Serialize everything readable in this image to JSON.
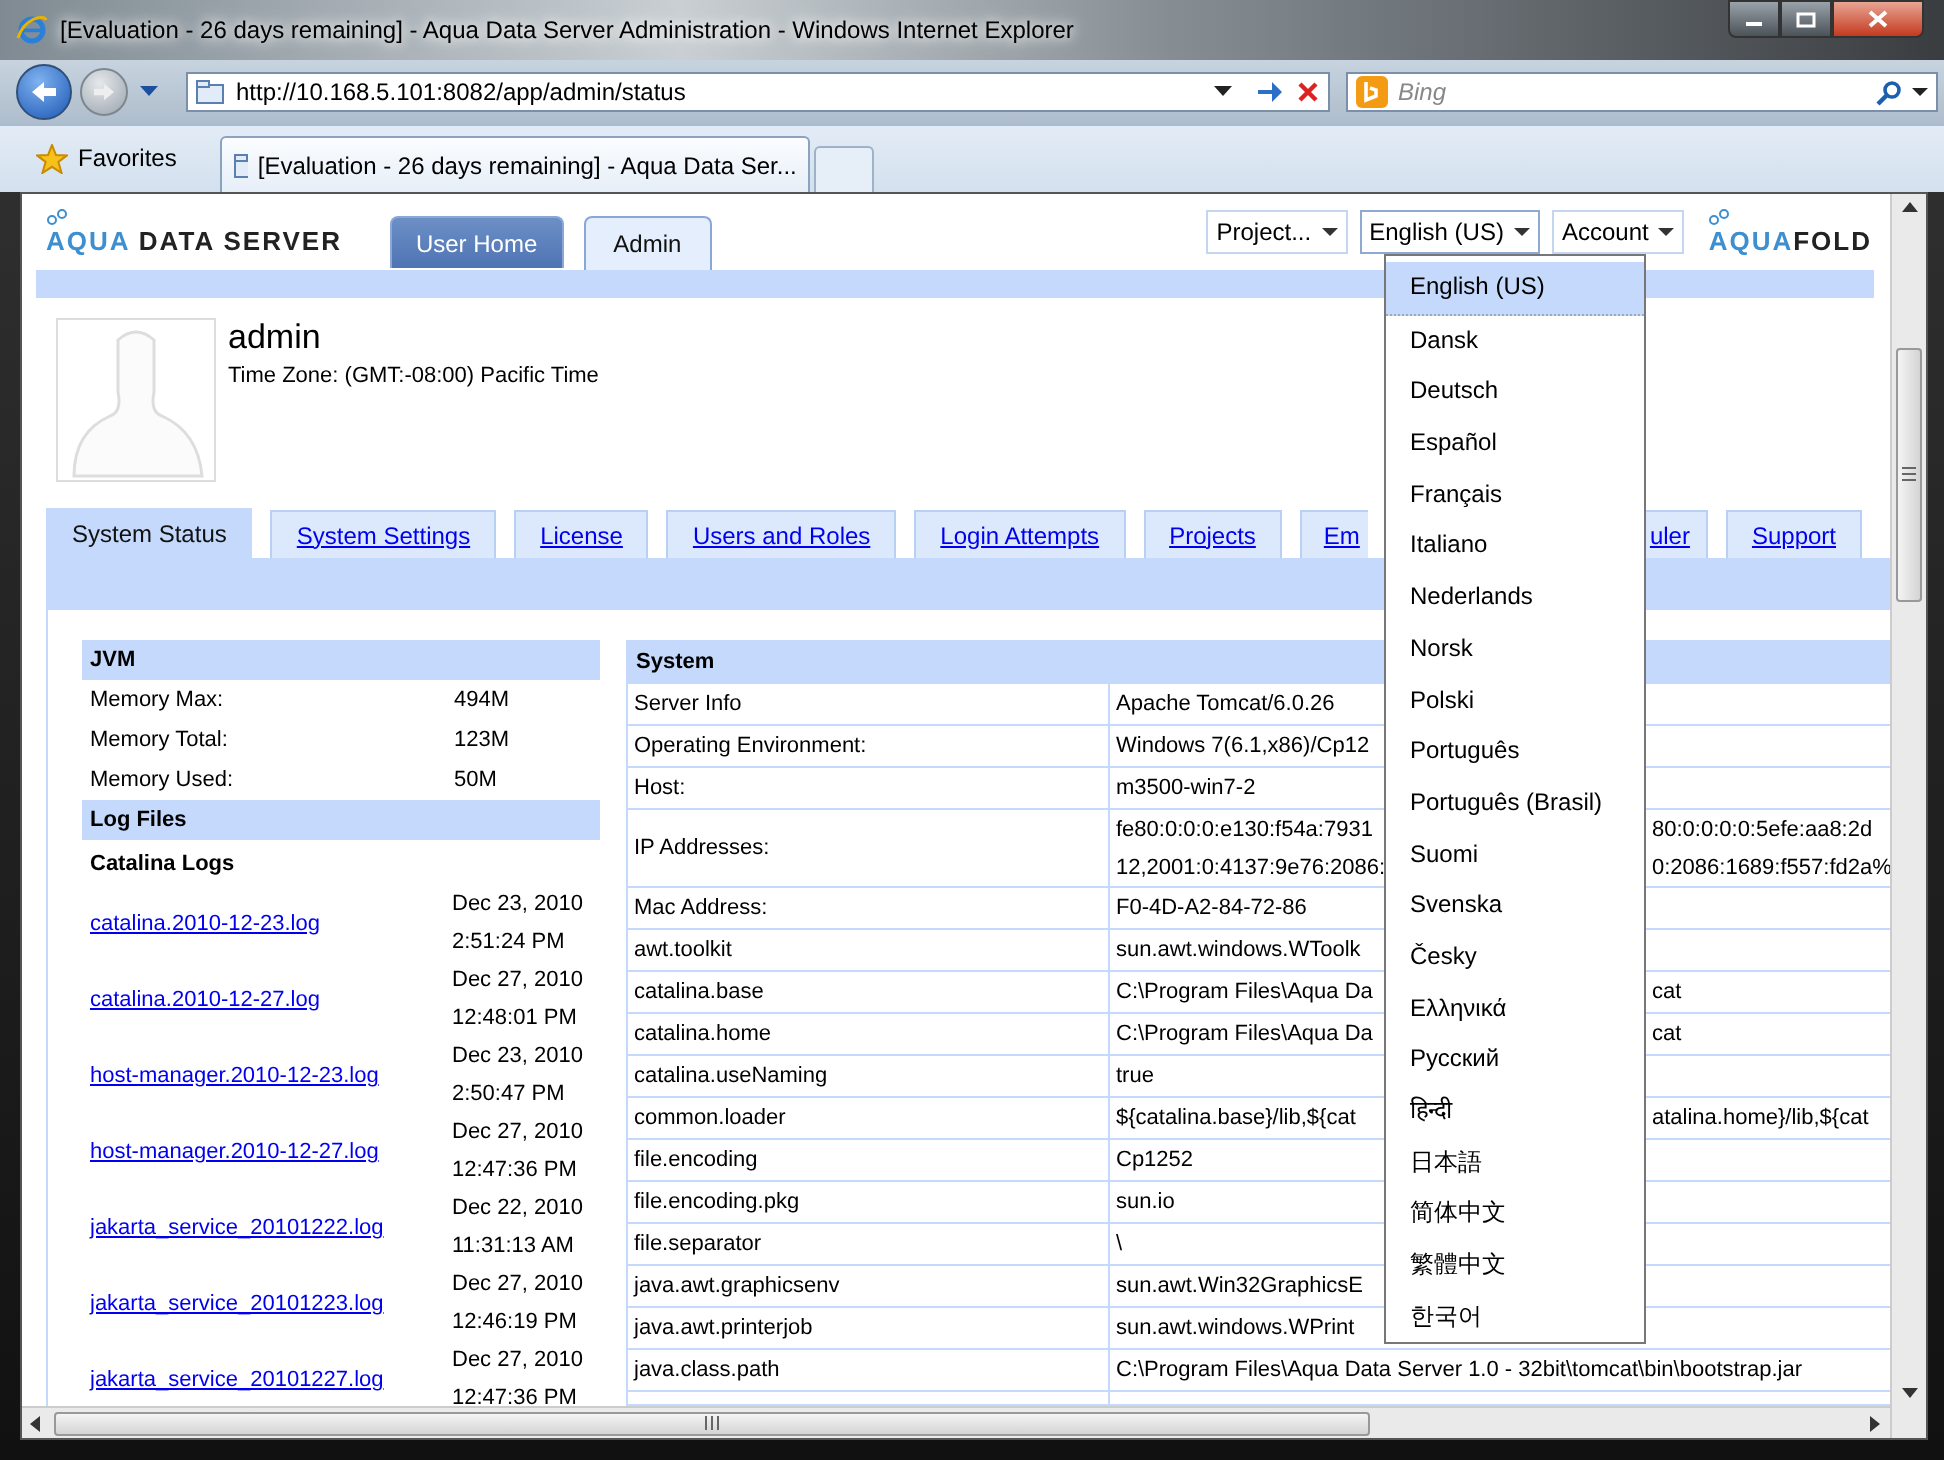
{
  "window": {
    "title": "[Evaluation - 26 days remaining] - Aqua Data Server Administration - Windows Internet Explorer"
  },
  "address_bar": {
    "url": "http://10.168.5.101:8082/app/admin/status"
  },
  "search": {
    "placeholder": "Bing"
  },
  "favorites": {
    "label": "Favorites"
  },
  "browser_tabs": [
    {
      "label": "[Evaluation - 26 days remaining] - Aqua Data Ser...",
      "selected": true
    }
  ],
  "logo": {
    "part_1": "AQUA",
    "part_2": "DATA SERVER"
  },
  "vendor_logo": {
    "part_1": "AQUA",
    "part_2": "FOLD"
  },
  "app_tabs": [
    {
      "label": "User Home",
      "selected": false
    },
    {
      "label": "Admin",
      "selected": true
    }
  ],
  "menus": [
    {
      "label": "Project...",
      "open": false
    },
    {
      "label": "English (US)",
      "open": true
    },
    {
      "label": "Account",
      "open": false
    }
  ],
  "language_menu": [
    {
      "label": "English (US)",
      "selected": true
    },
    {
      "label": "Dansk",
      "selected": false
    },
    {
      "label": "Deutsch",
      "selected": false
    },
    {
      "label": "Español",
      "selected": false
    },
    {
      "label": "Français",
      "selected": false
    },
    {
      "label": "Italiano",
      "selected": false
    },
    {
      "label": "Nederlands",
      "selected": false
    },
    {
      "label": "Norsk",
      "selected": false
    },
    {
      "label": "Polski",
      "selected": false
    },
    {
      "label": "Português",
      "selected": false
    },
    {
      "label": "Português (Brasil)",
      "selected": false
    },
    {
      "label": "Suomi",
      "selected": false
    },
    {
      "label": "Svenska",
      "selected": false
    },
    {
      "label": "Česky",
      "selected": false
    },
    {
      "label": "Ελληνικά",
      "selected": false
    },
    {
      "label": "Русский",
      "selected": false
    },
    {
      "label": "हिन्दी",
      "selected": false
    },
    {
      "label": "日本語",
      "selected": false
    },
    {
      "label": "简体中文",
      "selected": false
    },
    {
      "label": "繁體中文",
      "selected": false
    },
    {
      "label": "한국어",
      "selected": false
    }
  ],
  "user": {
    "name": "admin",
    "time_zone": "Time Zone: (GMT:-08:00) Pacific Time"
  },
  "admin_tabs": [
    {
      "label": "System Status",
      "selected": true
    },
    {
      "label": "System Settings",
      "selected": false
    },
    {
      "label": "License",
      "selected": false
    },
    {
      "label": "Users and Roles",
      "selected": false
    },
    {
      "label": "Login Attempts",
      "selected": false
    },
    {
      "label": "Projects",
      "selected": false
    },
    {
      "label": "Em",
      "selected": false
    },
    {
      "label": "uler",
      "selected": false
    },
    {
      "label": "Support",
      "selected": false
    }
  ],
  "jvm": {
    "title": "JVM",
    "rows": [
      {
        "label": "Memory Max:",
        "value": "494M"
      },
      {
        "label": "Memory Total:",
        "value": "123M"
      },
      {
        "label": "Memory Used:",
        "value": "50M"
      }
    ]
  },
  "log_files": {
    "title": "Log Files",
    "group": "Catalina Logs",
    "files": [
      {
        "name": "catalina.2010-12-23.log",
        "date": "Dec 23, 2010",
        "time": "2:51:24 PM"
      },
      {
        "name": "catalina.2010-12-27.log",
        "date": "Dec 27, 2010",
        "time": "12:48:01 PM"
      },
      {
        "name": "host-manager.2010-12-23.log",
        "date": "Dec 23, 2010",
        "time": "2:50:47 PM"
      },
      {
        "name": "host-manager.2010-12-27.log",
        "date": "Dec 27, 2010",
        "time": "12:47:36 PM"
      },
      {
        "name": "jakarta_service_20101222.log",
        "date": "Dec 22, 2010",
        "time": "11:31:13 AM"
      },
      {
        "name": "jakarta_service_20101223.log",
        "date": "Dec 27, 2010",
        "time": "12:46:19 PM"
      },
      {
        "name": "jakarta_service_20101227.log",
        "date": "Dec 27, 2010",
        "time": "12:47:36 PM"
      }
    ]
  },
  "system": {
    "title": "System",
    "rows": [
      {
        "label": "Server Info",
        "lines": [
          {
            "text": "Apache Tomcat/6.0.26"
          }
        ]
      },
      {
        "label": "Operating Environment:",
        "lines": [
          {
            "text": "Windows 7(6.1,x86)/Cp12"
          }
        ]
      },
      {
        "label": "Host:",
        "lines": [
          {
            "text": "m3500-win7-2"
          }
        ]
      },
      {
        "label": "IP Addresses:",
        "lines": [
          {
            "text": "fe80:0:0:0:e130:f54a:7931",
            "text_right": "80:0:0:0:0:5efe:aa8:2d"
          },
          {
            "text": "12,2001:0:4137:9e76:2086:",
            "text_right": "0:2086:1689:f557:fd2a%"
          }
        ]
      },
      {
        "label": "Mac Address:",
        "lines": [
          {
            "text": "F0-4D-A2-84-72-86"
          }
        ]
      },
      {
        "label": "awt.toolkit",
        "lines": [
          {
            "text": "sun.awt.windows.WToolk"
          }
        ]
      },
      {
        "label": "catalina.base",
        "lines": [
          {
            "text": "C:\\Program Files\\Aqua Da",
            "text_right": "cat"
          }
        ]
      },
      {
        "label": "catalina.home",
        "lines": [
          {
            "text": "C:\\Program Files\\Aqua Da",
            "text_right": "cat"
          }
        ]
      },
      {
        "label": "catalina.useNaming",
        "lines": [
          {
            "text": "true"
          }
        ]
      },
      {
        "label": "common.loader",
        "lines": [
          {
            "text": "${catalina.base}/lib,${cat",
            "text_right": "atalina.home}/lib,${cat"
          }
        ]
      },
      {
        "label": "file.encoding",
        "lines": [
          {
            "text": "Cp1252"
          }
        ]
      },
      {
        "label": "file.encoding.pkg",
        "lines": [
          {
            "text": "sun.io"
          }
        ]
      },
      {
        "label": "file.separator",
        "lines": [
          {
            "text": "\\"
          }
        ]
      },
      {
        "label": "java.awt.graphicsenv",
        "lines": [
          {
            "text": "sun.awt.Win32GraphicsE"
          }
        ]
      },
      {
        "label": "java.awt.printerjob",
        "lines": [
          {
            "text": "sun.awt.windows.WPrint"
          }
        ]
      },
      {
        "label": "java.class.path",
        "lines": [
          {
            "text": "C:\\Program Files\\Aqua Data Server 1.0 - 32bit\\tomcat\\bin\\bootstrap.jar"
          }
        ]
      }
    ]
  }
}
